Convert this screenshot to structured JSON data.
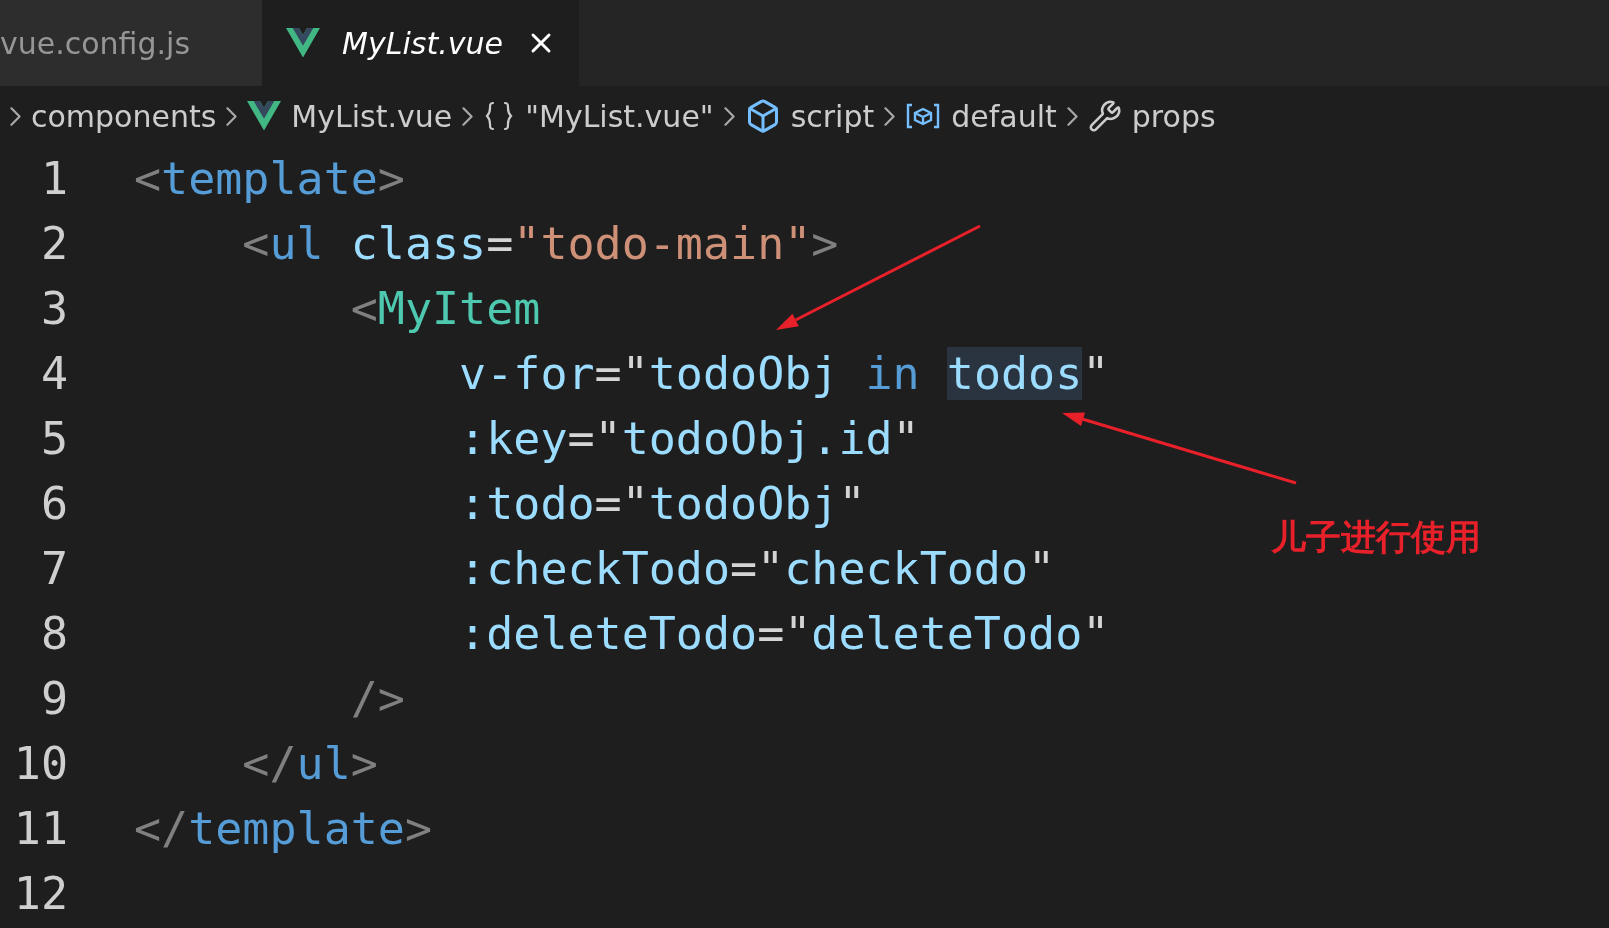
{
  "tabs": [
    {
      "label": "vue.config.js",
      "kind": "plain",
      "selected": false,
      "closable": false
    },
    {
      "label": "MyList.vue",
      "kind": "vue",
      "selected": true,
      "closable": true
    }
  ],
  "breadcrumbs": [
    {
      "label": "components",
      "kind": "folder"
    },
    {
      "label": "MyList.vue",
      "kind": "vue"
    },
    {
      "label": "\"MyList.vue\"",
      "kind": "object"
    },
    {
      "label": "script",
      "kind": "module"
    },
    {
      "label": "default",
      "kind": "field"
    },
    {
      "label": "props",
      "kind": "property"
    }
  ],
  "editor": {
    "lines": [
      {
        "number": "1",
        "tokens": [
          {
            "text": "<",
            "kind": "punct"
          },
          {
            "text": "template",
            "kind": "tag"
          },
          {
            "text": ">",
            "kind": "punct"
          }
        ]
      },
      {
        "number": "2",
        "tokens": [
          {
            "text": "    <",
            "kind": "punct"
          },
          {
            "text": "ul",
            "kind": "tag"
          },
          {
            "text": " class",
            "kind": "attr"
          },
          {
            "text": "=",
            "kind": "plain"
          },
          {
            "text": "\"todo-main\"",
            "kind": "string"
          },
          {
            "text": ">",
            "kind": "punct"
          }
        ]
      },
      {
        "number": "3",
        "tokens": [
          {
            "text": "        <",
            "kind": "punct"
          },
          {
            "text": "MyItem",
            "kind": "component"
          }
        ]
      },
      {
        "number": "4",
        "tokens": [
          {
            "text": "            v-for",
            "kind": "attr"
          },
          {
            "text": "=\"",
            "kind": "plain"
          },
          {
            "text": "todoObj",
            "kind": "attr"
          },
          {
            "text": " in ",
            "kind": "tag"
          },
          {
            "text": "todos",
            "kind": "attr",
            "highlighted": true
          },
          {
            "text": "\"",
            "kind": "plain"
          }
        ]
      },
      {
        "number": "5",
        "tokens": [
          {
            "text": "            :key",
            "kind": "attr"
          },
          {
            "text": "=\"",
            "kind": "plain"
          },
          {
            "text": "todoObj.id",
            "kind": "attr"
          },
          {
            "text": "\"",
            "kind": "plain"
          }
        ]
      },
      {
        "number": "6",
        "tokens": [
          {
            "text": "            :todo",
            "kind": "attr"
          },
          {
            "text": "=\"",
            "kind": "plain"
          },
          {
            "text": "todoObj",
            "kind": "attr"
          },
          {
            "text": "\"",
            "kind": "plain"
          }
        ]
      },
      {
        "number": "7",
        "tokens": [
          {
            "text": "            :checkTodo",
            "kind": "attr"
          },
          {
            "text": "=\"",
            "kind": "plain"
          },
          {
            "text": "checkTodo",
            "kind": "attr"
          },
          {
            "text": "\"",
            "kind": "plain"
          }
        ]
      },
      {
        "number": "8",
        "tokens": [
          {
            "text": "            :deleteTodo",
            "kind": "attr"
          },
          {
            "text": "=\"",
            "kind": "plain"
          },
          {
            "text": "deleteTodo",
            "kind": "attr"
          },
          {
            "text": "\"",
            "kind": "plain"
          }
        ]
      },
      {
        "number": "9",
        "tokens": [
          {
            "text": "        />",
            "kind": "punct"
          }
        ]
      },
      {
        "number": "10",
        "tokens": [
          {
            "text": "    </",
            "kind": "punct"
          },
          {
            "text": "ul",
            "kind": "tag"
          },
          {
            "text": ">",
            "kind": "punct"
          }
        ]
      },
      {
        "number": "11",
        "tokens": [
          {
            "text": "</",
            "kind": "punct"
          },
          {
            "text": "template",
            "kind": "tag"
          },
          {
            "text": ">",
            "kind": "punct"
          }
        ]
      },
      {
        "number": "12"
      }
    ]
  },
  "annotation": {
    "text": "儿子进行使用",
    "color": "#e8202a"
  }
}
